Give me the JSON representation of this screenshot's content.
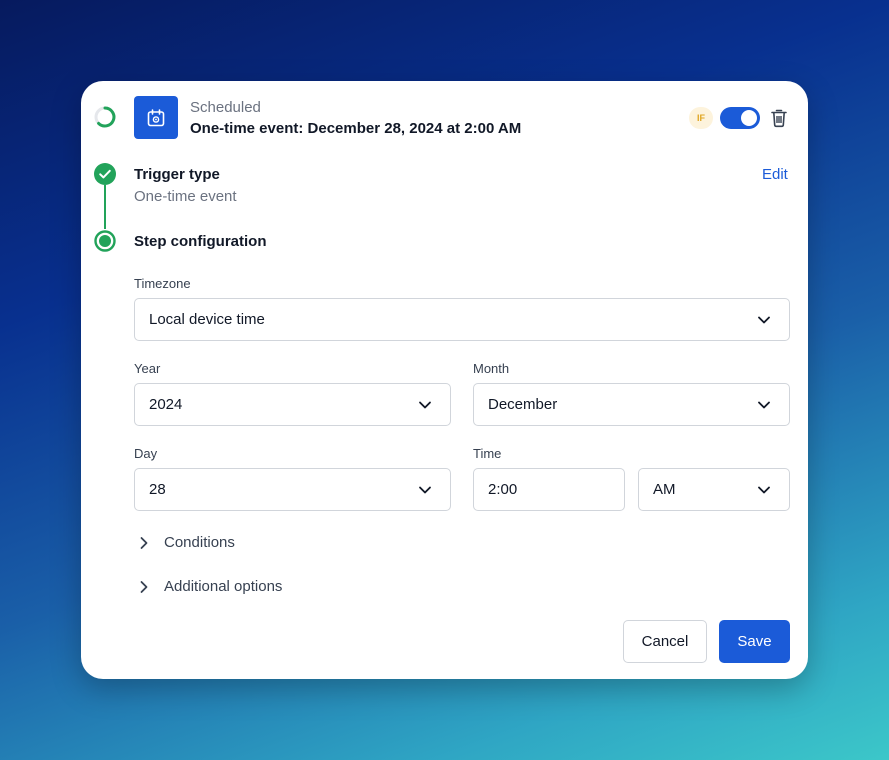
{
  "header": {
    "status": "Scheduled",
    "title": "One-time event: December 28, 2024 at 2:00 AM",
    "badge": "IF",
    "toggle_on": true,
    "icons": [
      "loading-spinner-icon",
      "calendar-icon",
      "trash-icon"
    ]
  },
  "steps": {
    "trigger": {
      "title": "Trigger type",
      "subtitle": "One-time event",
      "edit_label": "Edit"
    },
    "configuration": {
      "title": "Step configuration"
    }
  },
  "form": {
    "timezone": {
      "label": "Timezone",
      "value": "Local device time"
    },
    "year": {
      "label": "Year",
      "value": "2024"
    },
    "month": {
      "label": "Month",
      "value": "December"
    },
    "day": {
      "label": "Day",
      "value": "28"
    },
    "time": {
      "label": "Time",
      "value": "2:00",
      "period": "AM"
    }
  },
  "sections": {
    "conditions": "Conditions",
    "additional_options": "Additional options"
  },
  "actions": {
    "cancel": "Cancel",
    "save": "Save"
  },
  "colors": {
    "accent": "#1b5bd8",
    "success": "#22a35a",
    "badge_bg": "#fdf3dc",
    "badge_fg": "#e0a520"
  }
}
